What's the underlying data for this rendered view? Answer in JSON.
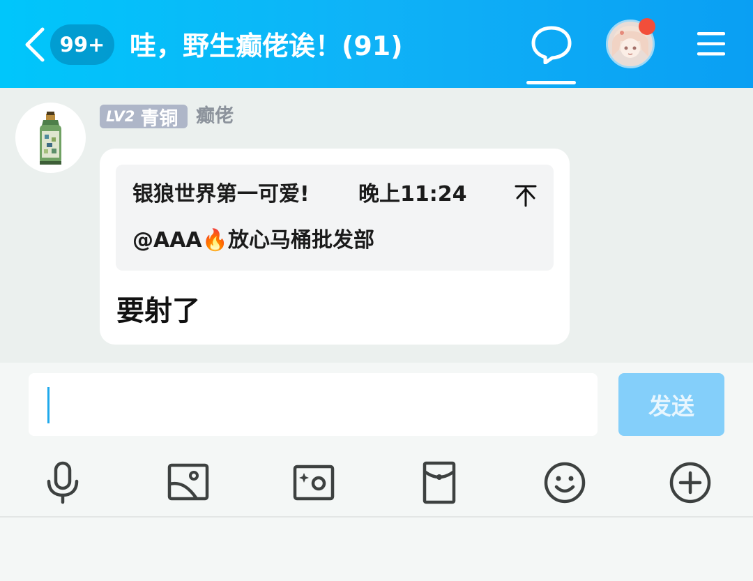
{
  "header": {
    "back_icon": "chevron-left-icon",
    "unread_badge": "99+",
    "title": "哇，野生癫佬诶！(91)",
    "chat_icon": "chat-bubble-icon",
    "menu_icon": "hamburger-menu-icon",
    "accent_color": "#0fb2f7",
    "notification_color": "#f24e3a"
  },
  "message": {
    "sender_level": "LV2",
    "sender_rank": "青铜",
    "sender_name": "癫佬",
    "quote": {
      "author": "银狼世界第一可爱!",
      "time": "晚上11:24",
      "content": "@AAA🔥放心马桶批发部",
      "jump_icon": "arrow-up-to-top-icon"
    },
    "text": "要射了"
  },
  "input": {
    "value": "",
    "send_label": "发送",
    "send_color": "#84cffa"
  },
  "toolbar": {
    "items": [
      {
        "name": "microphone-icon"
      },
      {
        "name": "image-icon"
      },
      {
        "name": "camera-icon"
      },
      {
        "name": "red-packet-icon"
      },
      {
        "name": "emoji-icon"
      },
      {
        "name": "plus-circle-icon"
      }
    ]
  }
}
